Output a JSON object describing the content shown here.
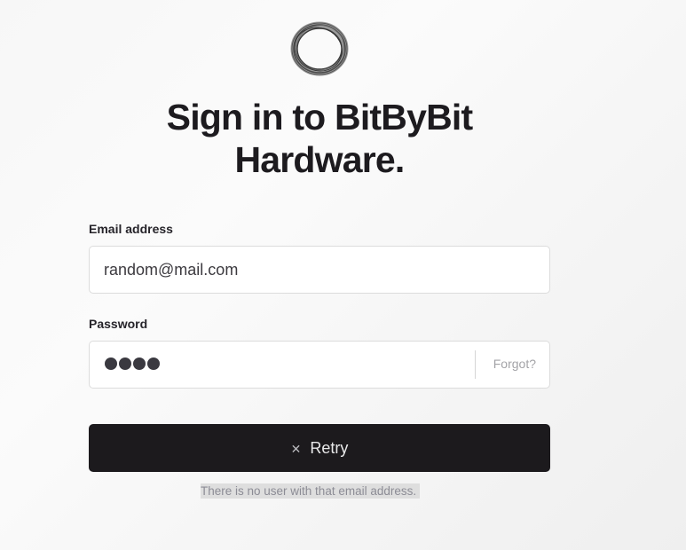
{
  "app": {
    "logo_icon": "swirl-ring-logo",
    "title_line1": "Sign in to BitByBit",
    "title_line2": "Hardware."
  },
  "form": {
    "email": {
      "label": "Email address",
      "value": "random@mail.com"
    },
    "password": {
      "label": "Password",
      "masked_length": 4,
      "forgot_label": "Forgot?"
    },
    "submit": {
      "label": "Retry",
      "icon": "close-icon"
    },
    "error_message": "There is no user with that email address."
  },
  "colors": {
    "button_bg": "#1c1a1d",
    "error_highlight": "#dedede",
    "text_dark": "#1d1b1f"
  }
}
